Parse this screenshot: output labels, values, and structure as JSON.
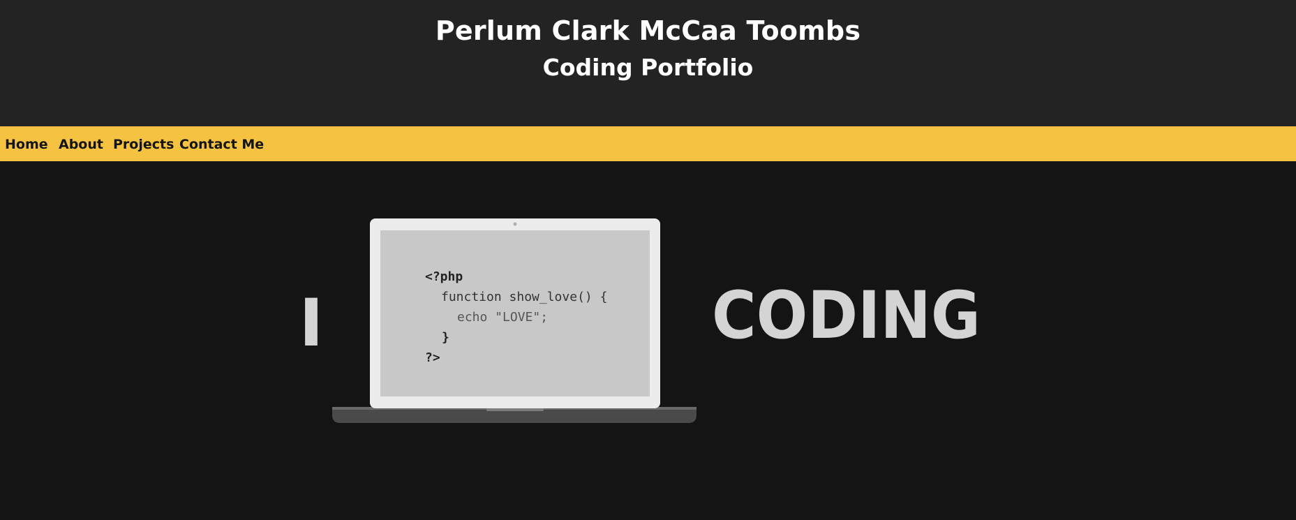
{
  "header": {
    "title": "Perlum Clark McCaa Toombs",
    "subtitle": "Coding Portfolio"
  },
  "nav": {
    "items": [
      "Home",
      "About",
      "Projects",
      "Contact Me"
    ]
  },
  "hero": {
    "left_word": "I",
    "right_word": "CODING",
    "code_lines": [
      "<?php",
      "function show_love() {",
      "echo \"LOVE\";",
      "}",
      "?>"
    ]
  },
  "colors": {
    "header_bg": "#232323",
    "nav_bg": "#f5c242",
    "page_bg": "#141414",
    "text_light": "#ffffff",
    "hero_text": "#d4d4d4"
  }
}
